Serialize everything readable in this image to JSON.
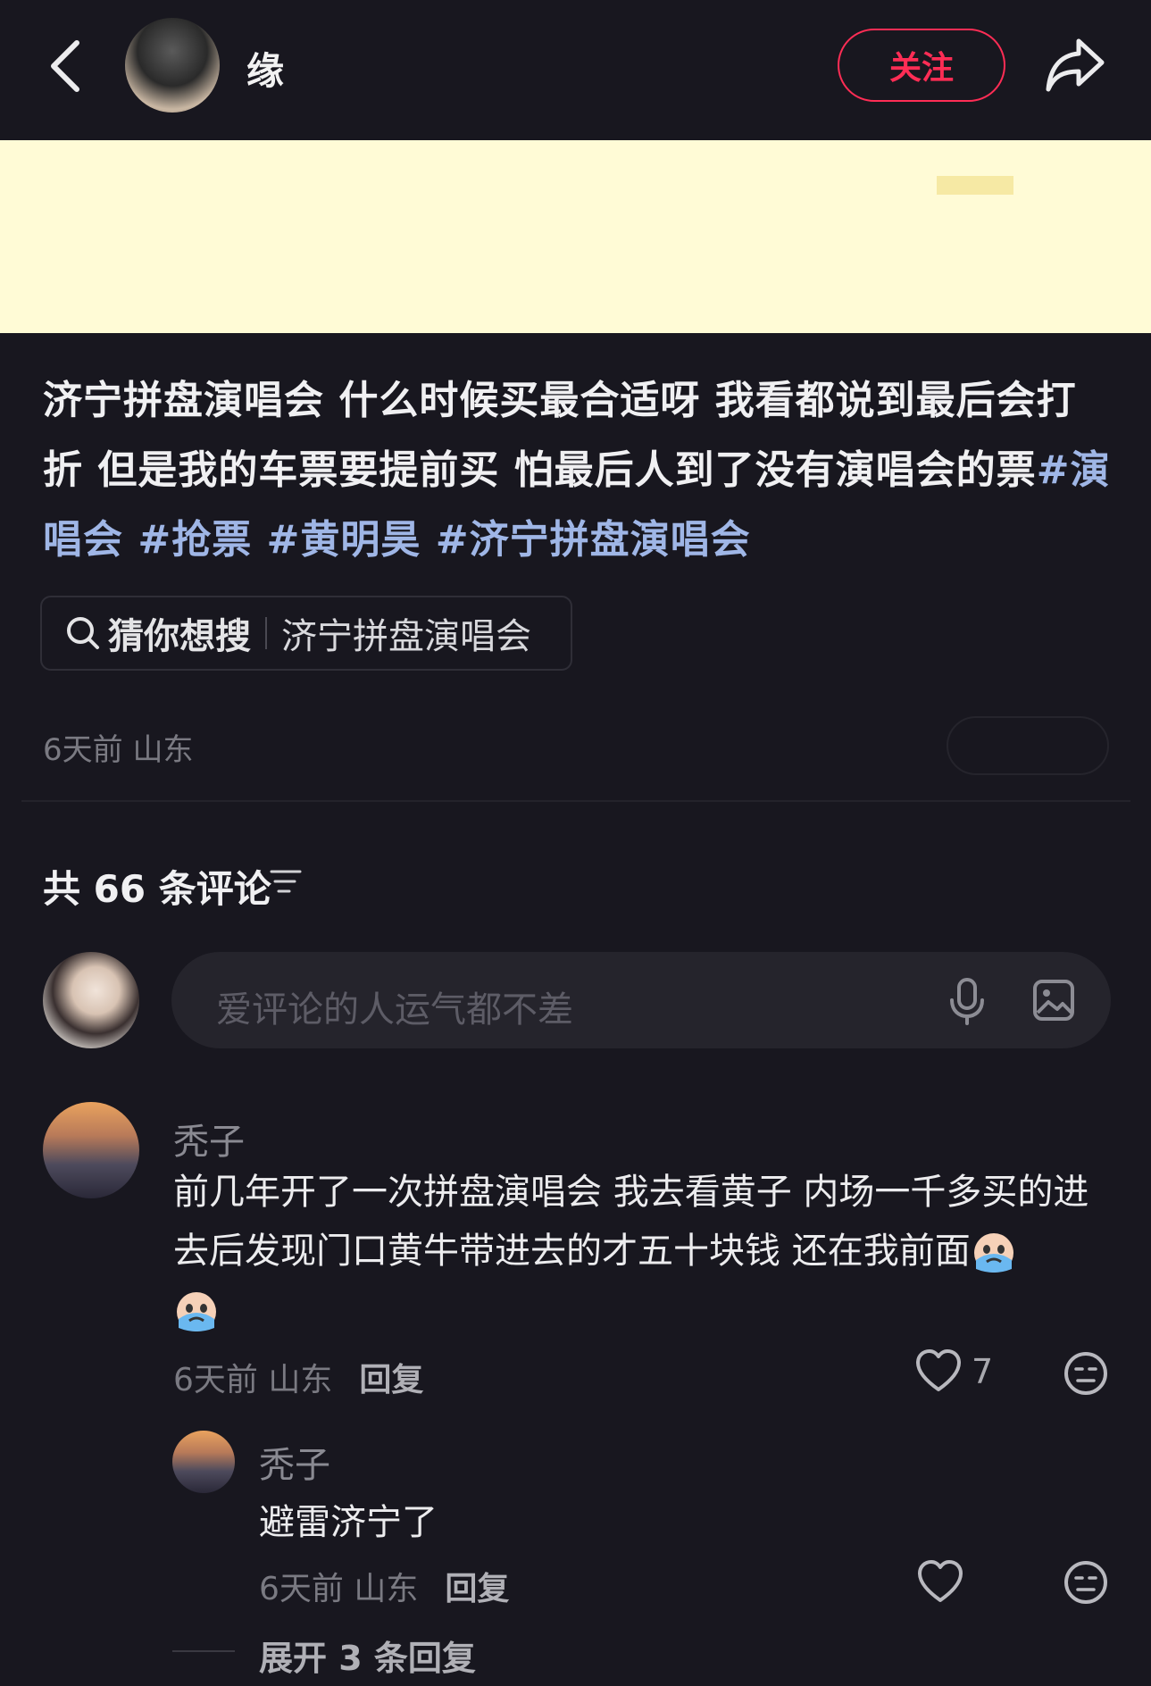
{
  "header": {
    "author_name": "缘",
    "follow_label": "关注"
  },
  "post": {
    "text": "济宁拼盘演唱会 什么时候买最合适呀 我看都说到最后会打折 但是我的车票要提前买 怕最后人到了没有演唱会的票",
    "tags": [
      "#演唱会",
      "#抢票",
      "#黄明昊",
      "#济宁拼盘演唱会"
    ],
    "search_chip": {
      "label": "猜你想搜",
      "query": "济宁拼盘演唱会"
    },
    "meta": "6天前 山东"
  },
  "comments": {
    "count_label": "共 66 条评论",
    "input_placeholder": "爱评论的人运气都不差",
    "items": [
      {
        "name": "秃子",
        "text": "前几年开了一次拼盘演唱会 我去看黄子 内场一千多买的进去后发现门口黄牛带进去的才五十块钱 还在我前面",
        "meta": "6天前 山东",
        "reply_label": "回复",
        "likes": "7",
        "replies": [
          {
            "name": "秃子",
            "text": "避雷济宁了",
            "meta": "6天前 山东",
            "reply_label": "回复"
          }
        ],
        "expand_label": "展开 3 条回复"
      }
    ]
  },
  "colors": {
    "background": "#18171f",
    "accent_red": "#ff2d55",
    "tag_blue": "#9fb6e6",
    "image_yellow": "#fffbd6"
  },
  "icons": [
    "back-icon",
    "share-icon",
    "search-icon",
    "sort-icon",
    "mic-icon",
    "image-icon",
    "heart-icon",
    "meh-face-icon",
    "crying-emoji-icon"
  ]
}
